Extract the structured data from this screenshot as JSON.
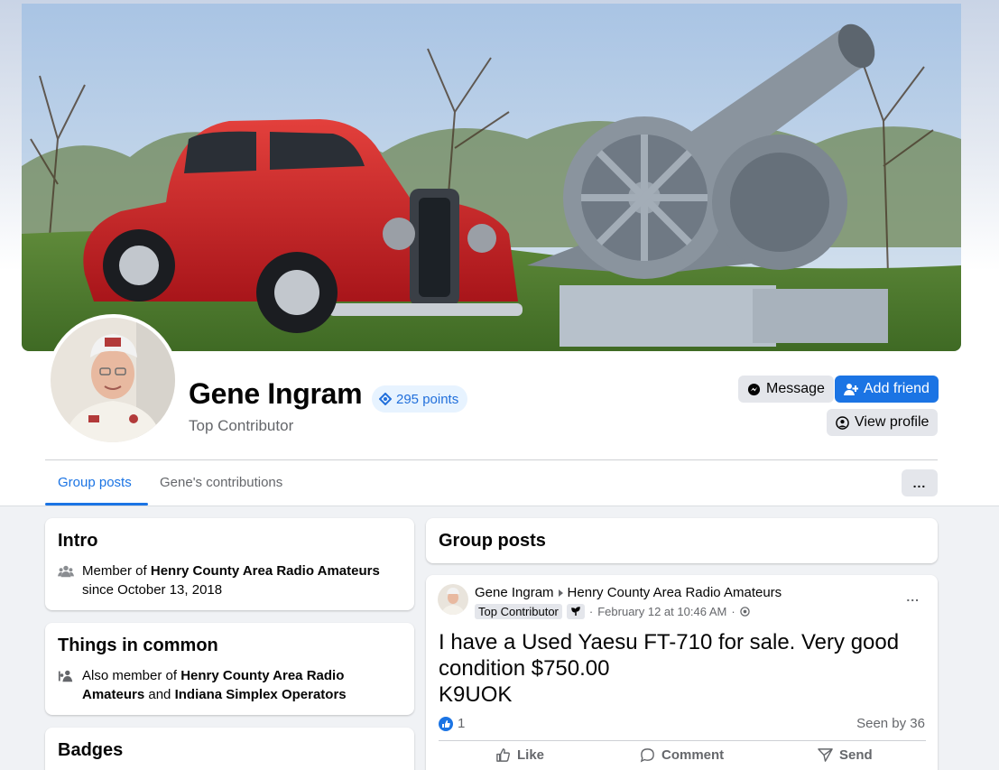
{
  "profile": {
    "name": "Gene Ingram",
    "points": "295 points",
    "role": "Top Contributor"
  },
  "actions": {
    "message": "Message",
    "add_friend": "Add friend",
    "view_profile": "View profile"
  },
  "tabs": [
    {
      "label": "Group posts",
      "active": true
    },
    {
      "label": "Gene's contributions",
      "active": false
    }
  ],
  "more_menu": "...",
  "intro": {
    "title": "Intro",
    "member_prefix": "Member of ",
    "group": "Henry County Area Radio Amateurs",
    "since": "since October 13, 2018"
  },
  "things_in_common": {
    "title": "Things in common",
    "prefix": "Also member of ",
    "group1": "Henry County Area Radio Amateurs",
    "joiner": " and ",
    "group2": "Indiana Simplex Operators"
  },
  "badges": {
    "title": "Badges"
  },
  "group_posts": {
    "title": "Group posts"
  },
  "post": {
    "author": "Gene Ingram",
    "group": "Henry County Area Radio Amateurs",
    "badge": "Top Contributor",
    "date": "February 12 at 10:46 AM",
    "text_lines": [
      "I have a Used Yaesu FT-710 for sale. Very good",
      "condition $750.00",
      "K9UOK"
    ],
    "likes": "1",
    "seen_by": "Seen by 36",
    "like_label": "Like",
    "comment_label": "Comment",
    "send_label": "Send",
    "options": "..."
  },
  "colors": {
    "accent": "#1b74e4",
    "background": "#f0f2f5",
    "secondary_text": "#65676b"
  }
}
